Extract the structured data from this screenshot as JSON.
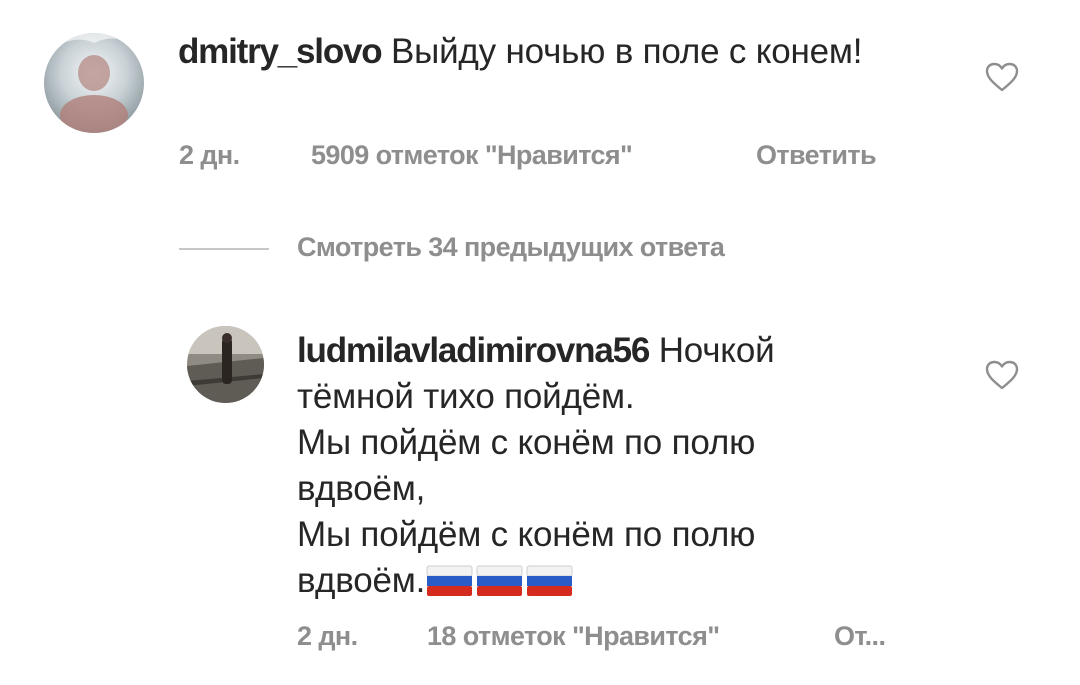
{
  "comments": [
    {
      "username": "dmitry_slovo",
      "text": "Выйду ночью в поле с конем!",
      "time": "2 дн.",
      "likes": "5909 отметок \"Нравится\"",
      "reply": "Ответить",
      "avatar_icon": "avatar-photo-icon"
    }
  ],
  "view_replies": {
    "label": "Смотреть 34 предыдущих ответа"
  },
  "replies": [
    {
      "username": "ludmilavladimirovna56",
      "text_line_1": "Ночкой",
      "text_line_2": "тёмной тихо пойдём.",
      "text_line_3": "Мы пойдём с конём по полю",
      "text_line_4": "вдвоём,",
      "text_line_5": "Мы пойдём с конём по полю",
      "text_line_6": "вдвоём.",
      "emoji": "russia-flag-icon x3",
      "time": "2 дн.",
      "likes": "18 отметок \"Нравится\"",
      "reply": "От...",
      "avatar_icon": "avatar-photo-icon"
    }
  ],
  "colors": {
    "text": "#262626",
    "secondary": "#8e8e8e",
    "divider": "#c7c7c7"
  }
}
